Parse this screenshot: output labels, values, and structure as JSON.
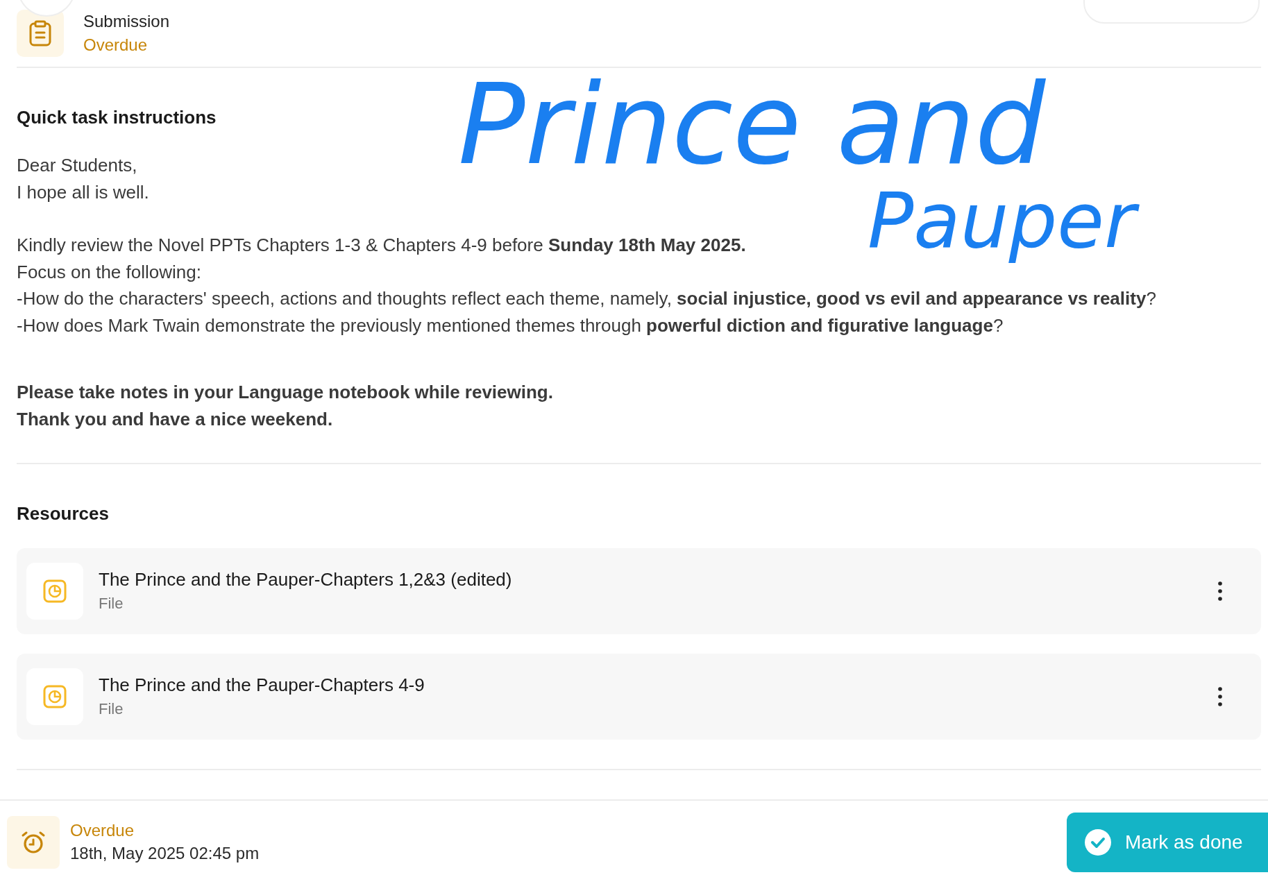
{
  "header": {
    "title": "Submission",
    "status": "Overdue"
  },
  "instructions": {
    "heading": "Quick task instructions",
    "paragraphs": [
      [
        "Dear Students,",
        "I hope all is well."
      ],
      [
        "Kindly review the Novel PPTs Chapters 1-3 & Chapters 4-9 before **Sunday 18th May 2025.**",
        "Focus on the following:",
        "-How do the characters' speech, actions and thoughts reflect each theme, namely, **social injustice, good vs evil and appearance vs reality**?",
        "-How does Mark Twain demonstrate the previously mentioned themes through **powerful diction and figurative language**?"
      ],
      [
        "**Please take notes  in your Language notebook while reviewing.**",
        "**Thank you and have a nice weekend.**"
      ]
    ]
  },
  "resources": {
    "heading": "Resources",
    "items": [
      {
        "title": "The Prince and the Pauper-Chapters 1,2&3 (edited)",
        "type": "File"
      },
      {
        "title": "The Prince and the Pauper-Chapters 4-9",
        "type": "File"
      }
    ]
  },
  "ink_note": {
    "lines": [
      "Prince and",
      "Pauper"
    ]
  },
  "footer": {
    "status": "Overdue",
    "due": "18th, May 2025 02:45 pm",
    "button": "Mark as done"
  }
}
